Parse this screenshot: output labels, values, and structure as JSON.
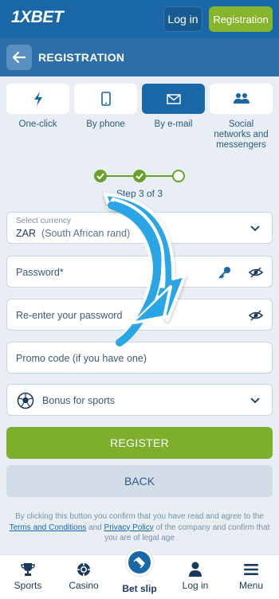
{
  "header": {
    "logo": "1XBET",
    "login_label": "Log in",
    "registration_label": "Registration"
  },
  "titlebar": {
    "title": "REGISTRATION"
  },
  "tabs": [
    {
      "label": "One-click",
      "icon": "lightning-icon"
    },
    {
      "label": "By phone",
      "icon": "phone-icon"
    },
    {
      "label": "By e-mail",
      "icon": "envelope-icon",
      "active": true
    },
    {
      "label": "Social networks and messengers",
      "icon": "people-icon"
    }
  ],
  "stepper": {
    "text": "Step 3 of 3",
    "current": 3,
    "total": 3
  },
  "form": {
    "currency_small_label": "Select currency",
    "currency_code": "ZAR",
    "currency_name": "(South African rand)",
    "password_label": "Password*",
    "reenter_label": "Re-enter your password",
    "promo_label": "Promo code (if you have one)",
    "bonus_label": "Bonus for sports"
  },
  "buttons": {
    "register": "REGISTER",
    "back": "BACK"
  },
  "legal": {
    "text1": "By clicking this button you confirm that you have read and agree to the",
    "terms": "Terms and Conditions",
    "and": "and",
    "privacy": "Privacy Policy",
    "text2": "of the company and confirm that you are of legal age"
  },
  "bottomnav": [
    {
      "label": "Sports",
      "icon": "trophy-icon"
    },
    {
      "label": "Casino",
      "icon": "casino-chip-icon"
    },
    {
      "label": "Bet slip",
      "icon": "ticket-icon"
    },
    {
      "label": "Log in",
      "icon": "user-icon"
    },
    {
      "label": "Menu",
      "icon": "hamburger-icon"
    }
  ],
  "colors": {
    "primary": "#1967a6",
    "accent_green": "#7dae2c",
    "overlay_arrow": "#2aa6e6"
  }
}
